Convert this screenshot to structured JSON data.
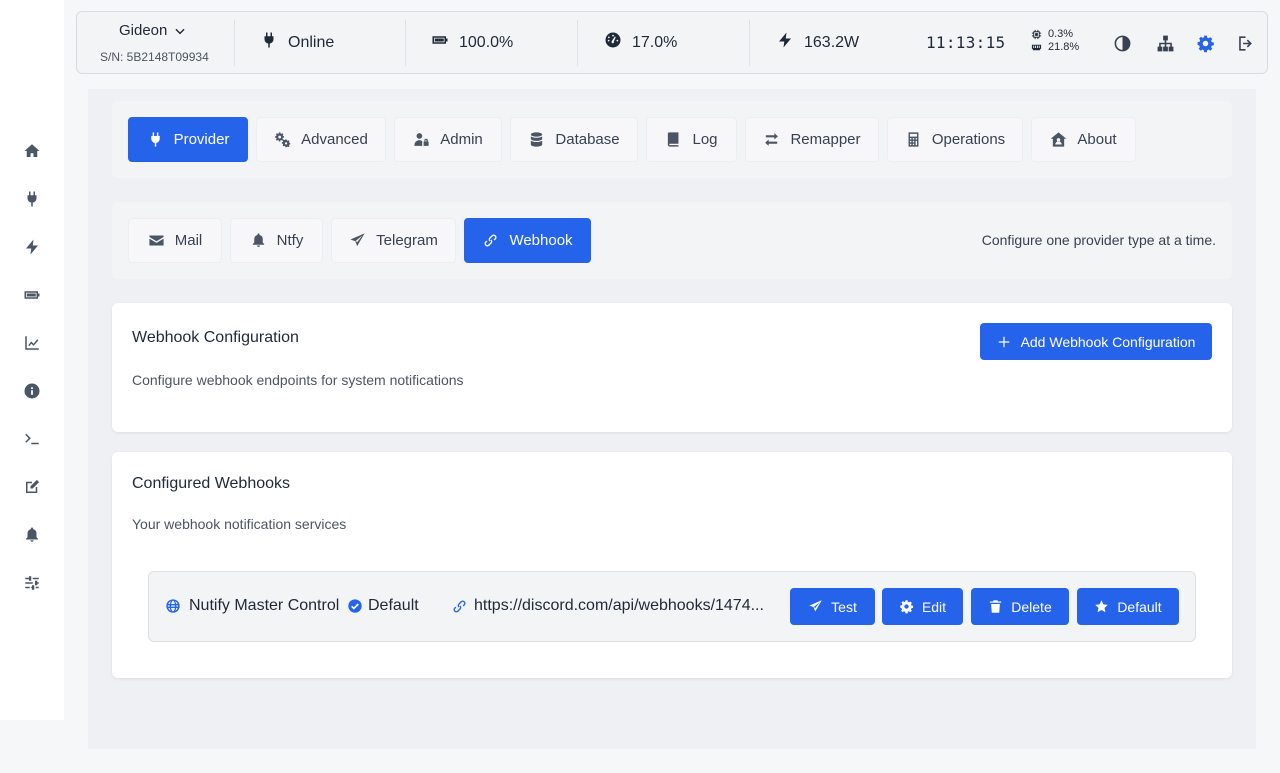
{
  "sidebar": {
    "items": [
      {
        "icon": "home-icon"
      },
      {
        "icon": "plug-icon"
      },
      {
        "icon": "bolt-icon"
      },
      {
        "icon": "battery-icon"
      },
      {
        "icon": "chart-line-icon"
      },
      {
        "icon": "info-icon"
      },
      {
        "icon": "terminal-icon"
      },
      {
        "icon": "edit-icon"
      },
      {
        "icon": "bell-icon"
      },
      {
        "icon": "sliders-icon"
      }
    ]
  },
  "topbar": {
    "device_name": "Gideon",
    "serial": "S/N: 5B2148T09934",
    "status": "Online",
    "battery": "100.0%",
    "load": "17.0%",
    "power": "163.2W",
    "time": "11:13:15",
    "cpu": "0.3%",
    "memory": "21.8%"
  },
  "tabs": [
    {
      "label": "Provider",
      "icon": "plug-icon",
      "active": true
    },
    {
      "label": "Advanced",
      "icon": "gears-icon",
      "active": false
    },
    {
      "label": "Admin",
      "icon": "user-lock-icon",
      "active": false
    },
    {
      "label": "Database",
      "icon": "database-icon",
      "active": false
    },
    {
      "label": "Log",
      "icon": "book-icon",
      "active": false
    },
    {
      "label": "Remapper",
      "icon": "arrows-icon",
      "active": false
    },
    {
      "label": "Operations",
      "icon": "calculator-icon",
      "active": false
    },
    {
      "label": "About",
      "icon": "house-user-icon",
      "active": false
    }
  ],
  "subtabs": [
    {
      "label": "Mail",
      "icon": "envelope-icon",
      "active": false
    },
    {
      "label": "Ntfy",
      "icon": "bell-icon",
      "active": false
    },
    {
      "label": "Telegram",
      "icon": "paper-plane-icon",
      "active": false
    },
    {
      "label": "Webhook",
      "icon": "link-icon",
      "active": true
    }
  ],
  "subtabs_hint": "Configure one provider type at a time.",
  "config_card": {
    "title": "Webhook Configuration",
    "subtitle": "Configure webhook endpoints for system notifications",
    "add_button": "Add Webhook Configuration"
  },
  "list_card": {
    "title": "Configured Webhooks",
    "subtitle": "Your webhook notification services",
    "webhooks": [
      {
        "name": "Nutify Master Control",
        "default_label": "Default",
        "url": "https://discord.com/api/webhooks/1474...",
        "actions": {
          "test": "Test",
          "edit": "Edit",
          "delete": "Delete",
          "default": "Default"
        }
      }
    ]
  },
  "colors": {
    "accent": "#2563eb",
    "background": "#eff0f3"
  }
}
